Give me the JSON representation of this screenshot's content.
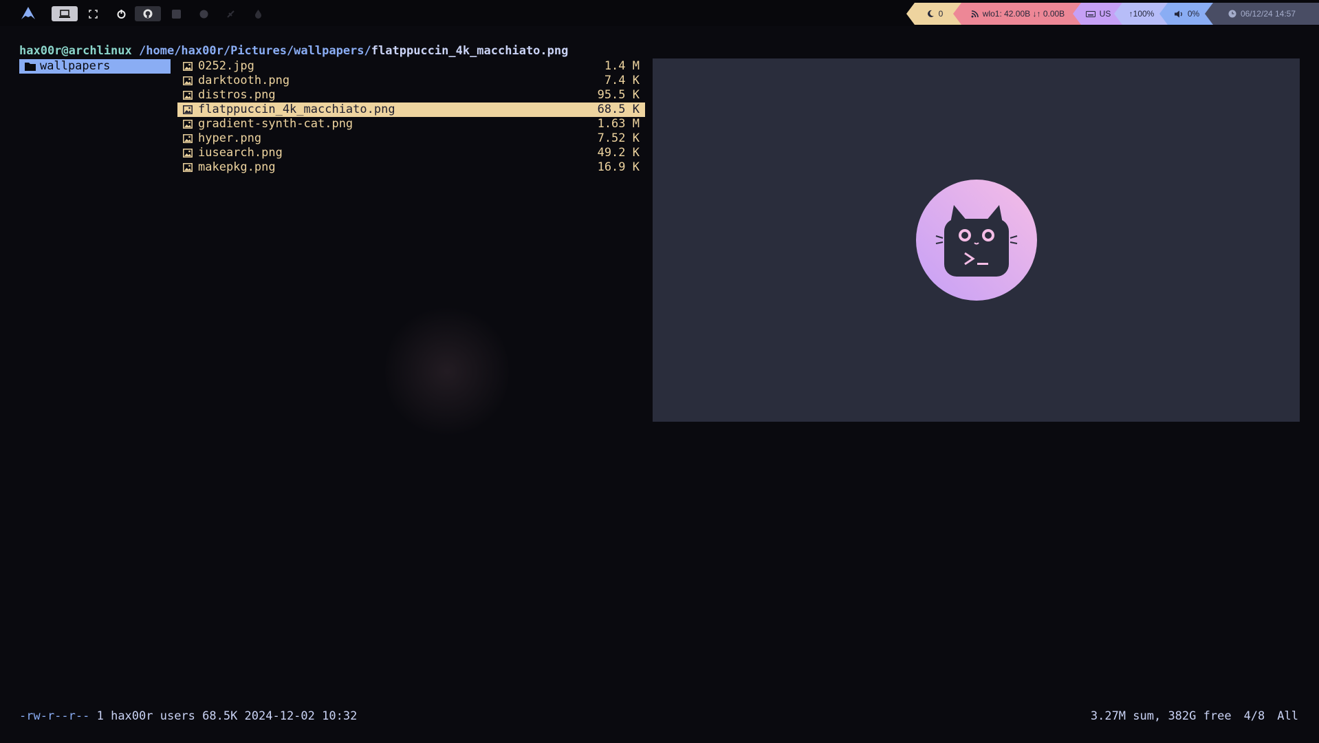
{
  "topbar": {
    "workspaces": [
      {
        "icon": "laptop-icon",
        "state": "active"
      },
      {
        "icon": "expand-icon",
        "state": "empty"
      },
      {
        "icon": "power-icon",
        "state": "empty"
      },
      {
        "icon": "github-icon",
        "state": "occupied"
      },
      {
        "icon": "terminal-icon",
        "state": "dim"
      },
      {
        "icon": "circle-icon",
        "state": "dim"
      },
      {
        "icon": "plug-icon",
        "state": "dim"
      },
      {
        "icon": "flame-icon",
        "state": "dim"
      }
    ],
    "modules": {
      "notifications": {
        "value": "0",
        "color": "#eed49f"
      },
      "network": {
        "text": "wlo1: 42.00B ↓↑ 0.00B",
        "color": "#ed8796"
      },
      "keyboard": {
        "text": "US",
        "color": "#c6a0f6"
      },
      "brightness": {
        "text": "↑100%",
        "color": "#b7bdf8"
      },
      "volume": {
        "text": "0%",
        "color": "#8aadf4"
      },
      "clock": {
        "text": "06/12/24 14:57",
        "color": "#494d64"
      }
    }
  },
  "ranger": {
    "path": {
      "user": "hax00r@archlinux",
      "dir": "/home/hax00r/Pictures/wallpapers/",
      "file": "flatppuccin_4k_macchiato.png"
    },
    "parent_items": [
      "wallpapers"
    ],
    "files": [
      {
        "name": "0252.jpg",
        "size": "1.4 M"
      },
      {
        "name": "darktooth.png",
        "size": "7.4 K"
      },
      {
        "name": "distros.png",
        "size": "95.5 K"
      },
      {
        "name": "flatppuccin_4k_macchiato.png",
        "size": "68.5 K",
        "selected": true
      },
      {
        "name": "gradient-synth-cat.png",
        "size": "1.63 M"
      },
      {
        "name": "hyper.png",
        "size": "7.52 K"
      },
      {
        "name": "iusearch.png",
        "size": "49.2 K"
      },
      {
        "name": "makepkg.png",
        "size": "16.9 K"
      }
    ],
    "status": {
      "permissions": "-rw-r--r--",
      "info": "1 hax00r users 68.5K 2024-12-02 10:32",
      "summary": "3.27M sum, 382G free",
      "position": "4/8",
      "scroll": "All"
    }
  },
  "colors": {
    "accent_yellow": "#eed49f",
    "accent_blue": "#8aadf4",
    "preview_bg": "#2a2d3c"
  }
}
